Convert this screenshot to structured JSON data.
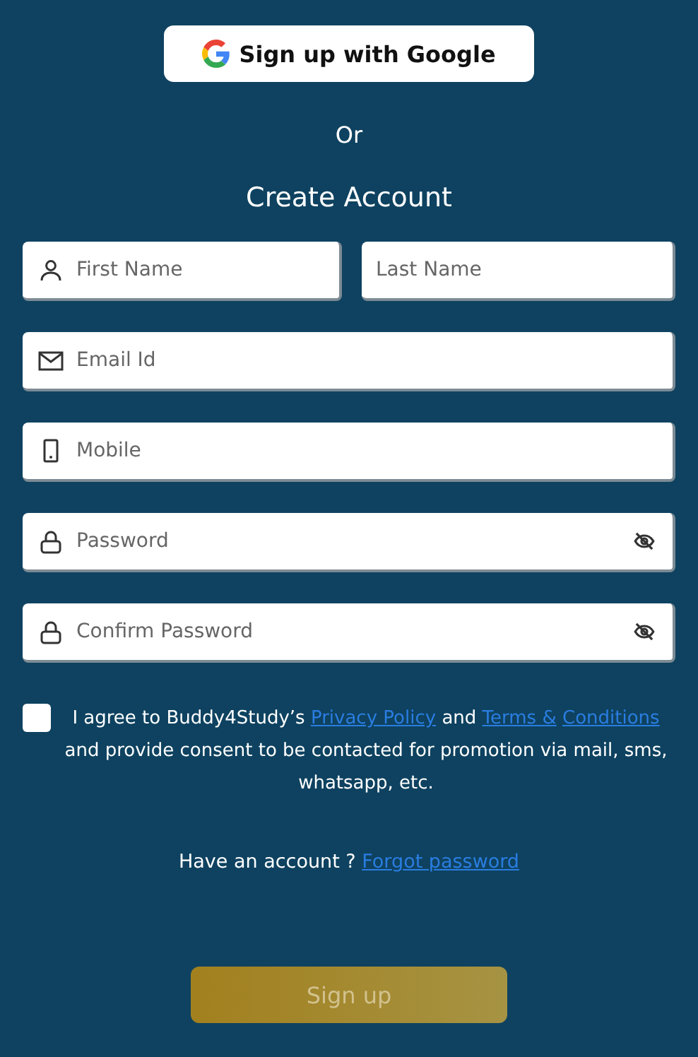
{
  "google_button": {
    "label": "Sign up with Google"
  },
  "divider_text": "Or",
  "heading": "Create Account",
  "field_rows": [
    [
      {
        "kind": "person",
        "placeholder": "First Name"
      },
      {
        "kind": "plain",
        "placeholder": "Last Name"
      }
    ],
    [
      {
        "kind": "email",
        "placeholder": "Email Id"
      }
    ],
    [
      {
        "kind": "mobile",
        "placeholder": "Mobile"
      }
    ],
    [
      {
        "kind": "password",
        "placeholder": "Password"
      }
    ],
    [
      {
        "kind": "password",
        "placeholder": "Confirm Password"
      }
    ]
  ],
  "consent": {
    "checked": false,
    "parts": [
      {
        "kind": "text",
        "text": "I agree to Buddy4Study’s "
      },
      {
        "kind": "link",
        "text": "Privacy Policy"
      },
      {
        "kind": "text",
        "text": " and "
      },
      {
        "kind": "link",
        "text": "Terms &"
      },
      {
        "kind": "link",
        "text": "Conditions"
      },
      {
        "kind": "text",
        "text": " and provide consent to be contacted for promotion via mail, sms, whatsapp, etc."
      }
    ]
  },
  "account_prompt": {
    "text": "Have an account ?",
    "link": "Forgot password"
  },
  "submit_button": {
    "label": "Sign up",
    "disabled": true
  }
}
